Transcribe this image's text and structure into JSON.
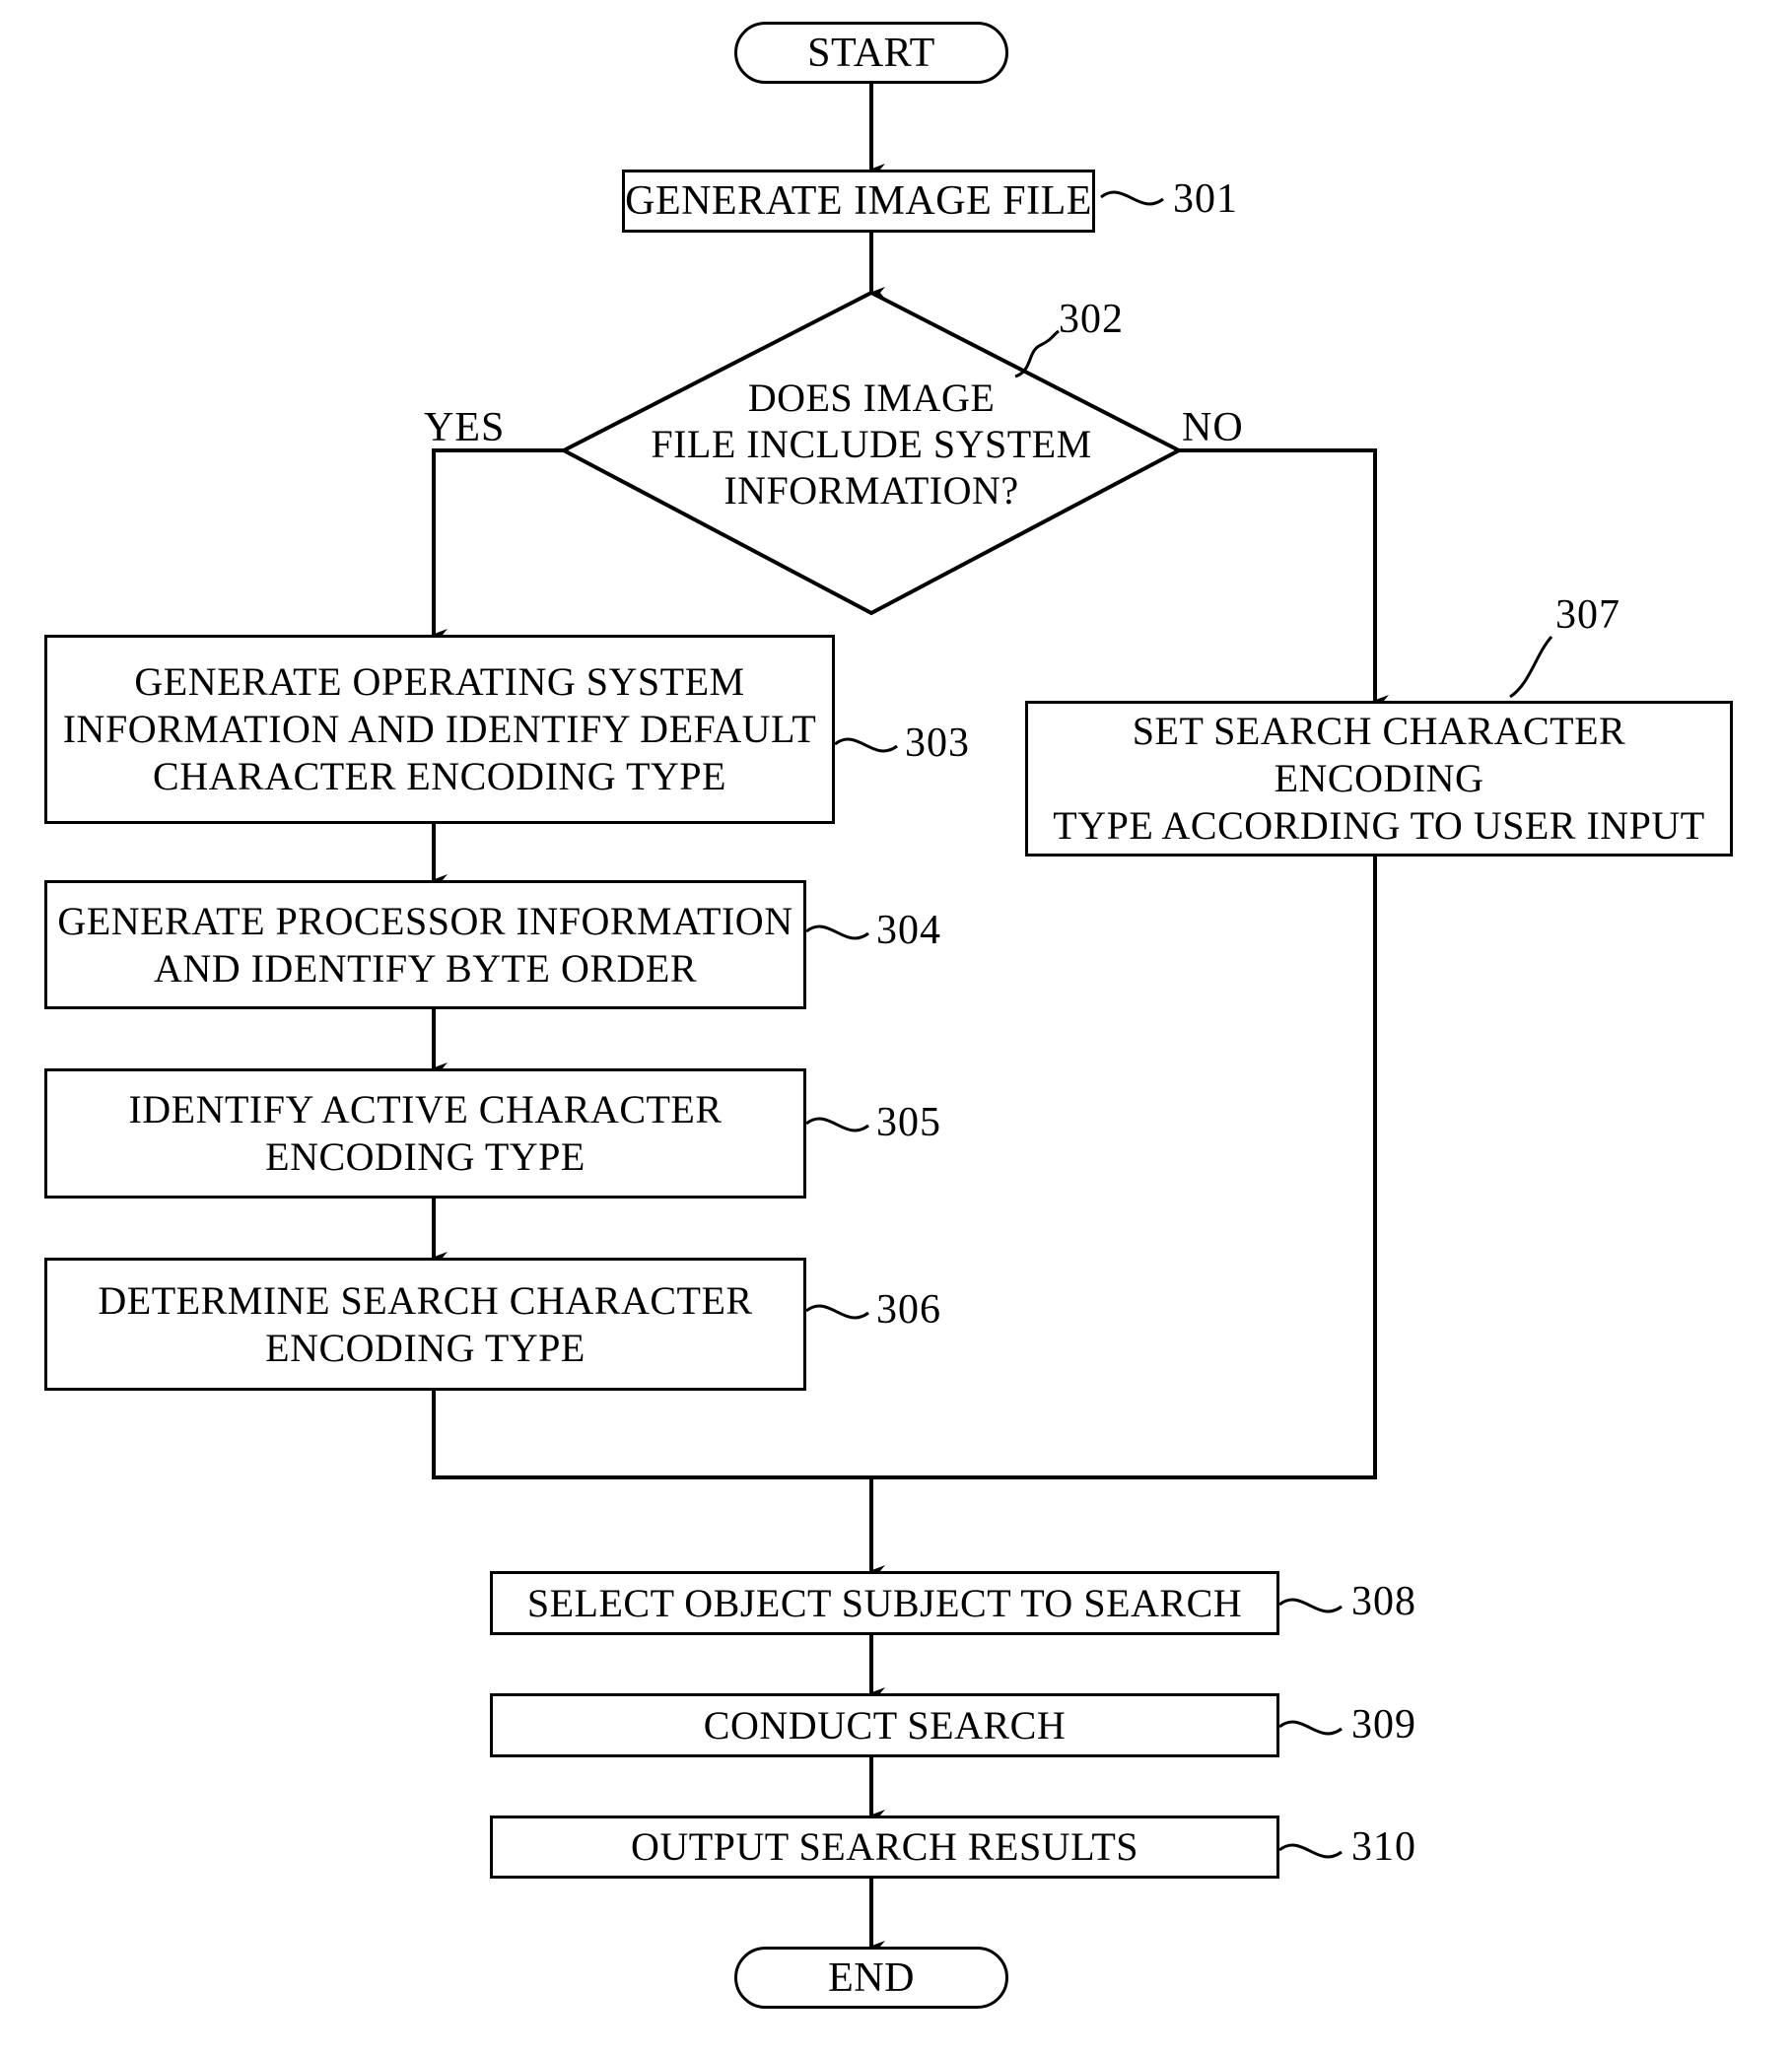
{
  "diagram": {
    "type": "flowchart",
    "title": "",
    "nodes": {
      "start": {
        "label": "START",
        "shape": "terminator"
      },
      "n301": {
        "label": "GENERATE IMAGE FILE",
        "shape": "process",
        "ref": "301"
      },
      "n302": {
        "line1": "DOES IMAGE",
        "line2": "FILE INCLUDE  SYSTEM",
        "line3": "INFORMATION?",
        "shape": "decision",
        "ref": "302"
      },
      "n303": {
        "line1": "GENERATE OPERATING SYSTEM",
        "line2": "INFORMATION AND IDENTIFY  DEFAULT",
        "line3": "CHARACTER ENCODING TYPE",
        "shape": "process",
        "ref": "303"
      },
      "n304": {
        "line1": "GENERATE PROCESSOR INFORMATION",
        "line2": "AND IDENTIFY BYTE ORDER",
        "shape": "process",
        "ref": "304"
      },
      "n305": {
        "line1": "IDENTIFY ACTIVE CHARACTER",
        "line2": "ENCODING TYPE",
        "shape": "process",
        "ref": "305"
      },
      "n306": {
        "line1": "DETERMINE SEARCH CHARACTER",
        "line2": "ENCODING TYPE",
        "shape": "process",
        "ref": "306"
      },
      "n307": {
        "line1": "SET SEARCH CHARACTER ENCODING",
        "line2": "TYPE ACCORDING TO USER INPUT",
        "shape": "process",
        "ref": "307"
      },
      "n308": {
        "label": "SELECT OBJECT SUBJECT TO SEARCH",
        "shape": "process",
        "ref": "308"
      },
      "n309": {
        "label": "CONDUCT SEARCH",
        "shape": "process",
        "ref": "309"
      },
      "n310": {
        "label": "OUTPUT SEARCH RESULTS",
        "shape": "process",
        "ref": "310"
      },
      "end": {
        "label": "END",
        "shape": "terminator"
      }
    },
    "branches": {
      "yes": "YES",
      "no": "NO"
    },
    "colors": {
      "stroke": "#000000",
      "background": "#ffffff",
      "text": "#000000"
    }
  }
}
